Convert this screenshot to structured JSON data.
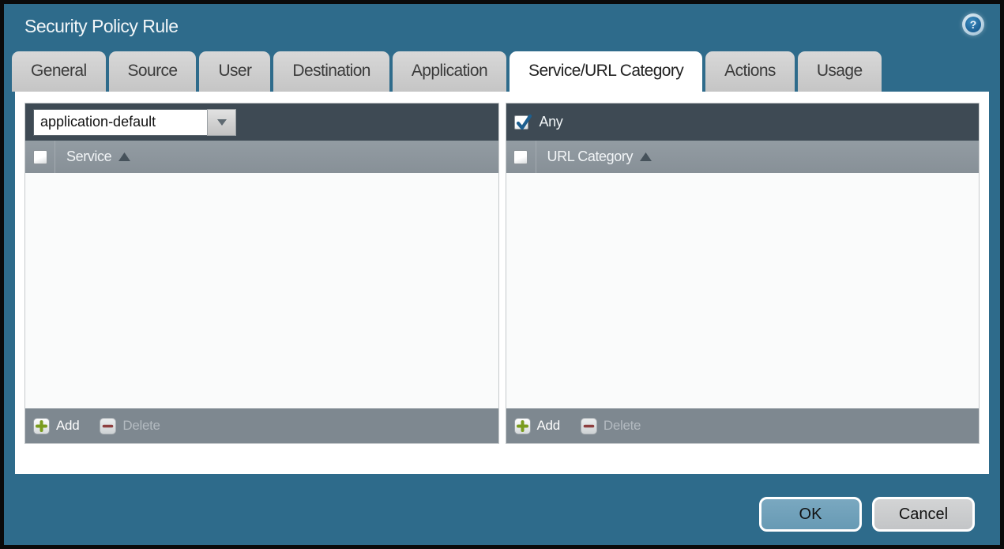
{
  "window": {
    "title": "Security Policy Rule",
    "help_icon_glyph": "?"
  },
  "tabs": [
    {
      "label": "General",
      "active": false
    },
    {
      "label": "Source",
      "active": false
    },
    {
      "label": "User",
      "active": false
    },
    {
      "label": "Destination",
      "active": false
    },
    {
      "label": "Application",
      "active": false
    },
    {
      "label": "Service/URL Category",
      "active": true
    },
    {
      "label": "Actions",
      "active": false
    },
    {
      "label": "Usage",
      "active": false
    }
  ],
  "service_panel": {
    "combo": {
      "value": "application-default"
    },
    "column_header": "Service",
    "header_checkbox_checked": false,
    "sort_direction": "asc",
    "rows": [],
    "add_label": "Add",
    "delete_label": "Delete",
    "delete_enabled": false
  },
  "url_category_panel": {
    "any_label": "Any",
    "any_checked": true,
    "column_header": "URL Category",
    "header_checkbox_checked": false,
    "sort_direction": "asc",
    "rows": [],
    "add_label": "Add",
    "delete_label": "Delete",
    "delete_enabled": false
  },
  "footer": {
    "ok_label": "OK",
    "cancel_label": "Cancel"
  },
  "colors": {
    "titlebar_teal": "#2e6b8b",
    "panel_header_dark": "#3e4a54",
    "column_header_gray": "#8c959c",
    "panel_footer_gray": "#7e8890",
    "ok_button_blue": "#6f9fb9",
    "cancel_button_gray": "#c9cbcd",
    "check_blue": "#1d5f8f",
    "add_plus_green": "#7a9c1e",
    "delete_minus_red": "#8d3f3f"
  }
}
